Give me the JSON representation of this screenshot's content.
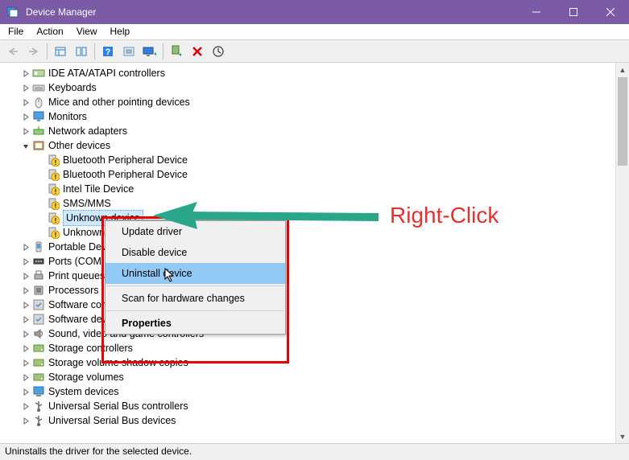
{
  "window": {
    "title": "Device Manager"
  },
  "menubar": [
    "File",
    "Action",
    "View",
    "Help"
  ],
  "toolbar_icons": [
    "back-icon",
    "forward-icon",
    "show-hide-icon",
    "properties-icon",
    "help-icon",
    "refresh-icon",
    "update-icon",
    "scan-icon",
    "remove-icon",
    "enable-icon"
  ],
  "tree": [
    {
      "indent": 1,
      "expand": "closed",
      "icon": "ide",
      "label": "IDE ATA/ATAPI controllers"
    },
    {
      "indent": 1,
      "expand": "closed",
      "icon": "keyboard",
      "label": "Keyboards"
    },
    {
      "indent": 1,
      "expand": "closed",
      "icon": "mouse",
      "label": "Mice and other pointing devices"
    },
    {
      "indent": 1,
      "expand": "closed",
      "icon": "monitor",
      "label": "Monitors"
    },
    {
      "indent": 1,
      "expand": "closed",
      "icon": "network",
      "label": "Network adapters"
    },
    {
      "indent": 1,
      "expand": "open",
      "icon": "other",
      "label": "Other devices"
    },
    {
      "indent": 2,
      "expand": "none",
      "icon": "warn",
      "label": "Bluetooth Peripheral Device"
    },
    {
      "indent": 2,
      "expand": "none",
      "icon": "warn",
      "label": "Bluetooth Peripheral Device"
    },
    {
      "indent": 2,
      "expand": "none",
      "icon": "warn",
      "label": "Intel Tile Device"
    },
    {
      "indent": 2,
      "expand": "none",
      "icon": "warn",
      "label": "SMS/MMS"
    },
    {
      "indent": 2,
      "expand": "none",
      "icon": "warn",
      "label": "Unknown device",
      "selected": true
    },
    {
      "indent": 2,
      "expand": "none",
      "icon": "warn",
      "label": "Unknown device",
      "clip": true
    },
    {
      "indent": 1,
      "expand": "closed",
      "icon": "portable",
      "label": "Portable Devices",
      "clip": true
    },
    {
      "indent": 1,
      "expand": "closed",
      "icon": "ports",
      "label": "Ports (COM & LPT)",
      "clip": true
    },
    {
      "indent": 1,
      "expand": "closed",
      "icon": "printer",
      "label": "Print queues",
      "clip": true
    },
    {
      "indent": 1,
      "expand": "closed",
      "icon": "cpu",
      "label": "Processors",
      "clip": true
    },
    {
      "indent": 1,
      "expand": "closed",
      "icon": "sw",
      "label": "Software components",
      "clip": true
    },
    {
      "indent": 1,
      "expand": "closed",
      "icon": "sw",
      "label": "Software devices",
      "clip": true
    },
    {
      "indent": 1,
      "expand": "closed",
      "icon": "sound",
      "label": "Sound, video and game controllers"
    },
    {
      "indent": 1,
      "expand": "closed",
      "icon": "storage",
      "label": "Storage controllers"
    },
    {
      "indent": 1,
      "expand": "closed",
      "icon": "storage",
      "label": "Storage volume shadow copies"
    },
    {
      "indent": 1,
      "expand": "closed",
      "icon": "storage",
      "label": "Storage volumes"
    },
    {
      "indent": 1,
      "expand": "closed",
      "icon": "system",
      "label": "System devices"
    },
    {
      "indent": 1,
      "expand": "closed",
      "icon": "usb",
      "label": "Universal Serial Bus controllers"
    },
    {
      "indent": 1,
      "expand": "closed",
      "icon": "usb",
      "label": "Universal Serial Bus devices"
    }
  ],
  "context_menu": {
    "items": [
      {
        "label": "Update driver",
        "type": "item"
      },
      {
        "label": "Disable device",
        "type": "item"
      },
      {
        "label": "Uninstall device",
        "type": "item",
        "highlight": true
      },
      {
        "type": "sep"
      },
      {
        "label": "Scan for hardware changes",
        "type": "item"
      },
      {
        "type": "sep"
      },
      {
        "label": "Properties",
        "type": "item",
        "bold": true
      }
    ]
  },
  "annotation": {
    "text": "Right-Click"
  },
  "statusbar": "Uninstalls the driver for the selected device."
}
